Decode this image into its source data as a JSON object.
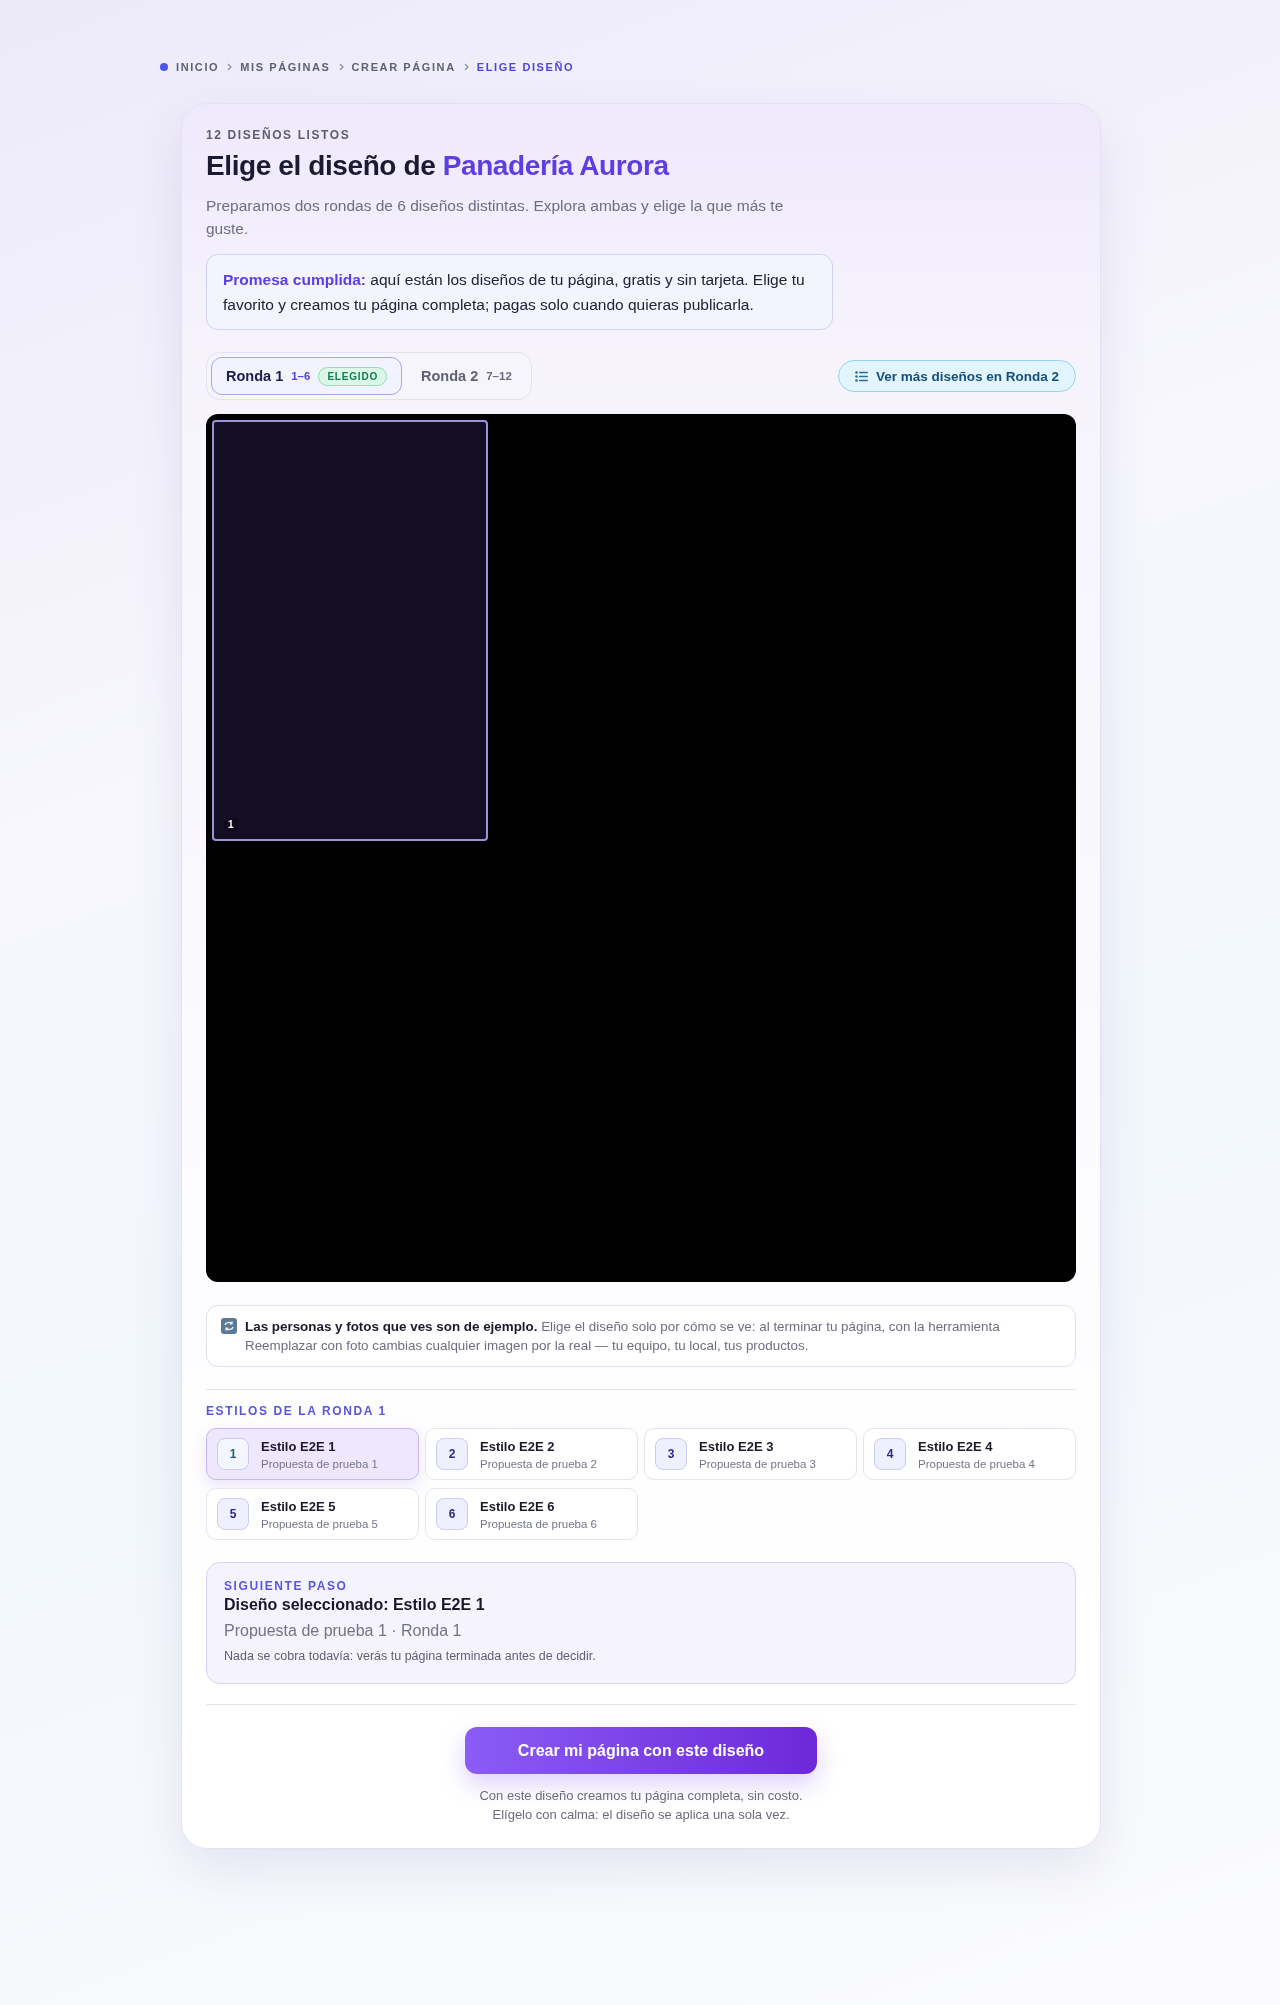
{
  "breadcrumb": [
    {
      "label": "INICIO",
      "current": false
    },
    {
      "label": "MIS PÁGINAS",
      "current": false
    },
    {
      "label": "CREAR PÁGINA",
      "current": false
    },
    {
      "label": "ELIGE DISEÑO",
      "current": true
    }
  ],
  "header": {
    "eyebrow": "12 DISEÑOS LISTOS",
    "title": "Elige el diseño de **Panadería Aurora**",
    "subtitle": "Preparamos dos rondas de 6 diseños distintas. Explora ambas y elige la que más te guste."
  },
  "promise": "**Promesa cumplida:** aquí están los diseños de tu página, gratis y sin tarjeta. Elige tu favorito y creamos tu página completa; pagas solo cuando quieras publicarla.",
  "rounds": [
    {
      "label": "Ronda 1",
      "range": "1–6",
      "badge": "ELEGIDO",
      "selected": true
    },
    {
      "label": "Ronda 2",
      "range": "7–12",
      "selected": false
    }
  ],
  "more_button": "Ver más diseños en Ronda 2",
  "preview": {
    "thumbnails": [
      {
        "label": "1",
        "selected": true
      }
    ]
  },
  "notice": "**Las personas y fotos que ves son de ejemplo.** Elige el diseño solo por cómo se ve: al terminar tu página, con la herramienta Reemplazar con foto cambias cualquier imagen por la real — tu equipo, tu local, tus productos.",
  "styles": {
    "heading": "ESTILOS DE LA RONDA 1",
    "items": [
      {
        "number": "1",
        "name": "Estilo E2E 1",
        "description": "Propuesta de prueba 1",
        "selected": true
      },
      {
        "number": "2",
        "name": "Estilo E2E 2",
        "description": "Propuesta de prueba 2",
        "selected": false
      },
      {
        "number": "3",
        "name": "Estilo E2E 3",
        "description": "Propuesta de prueba 3",
        "selected": false
      },
      {
        "number": "4",
        "name": "Estilo E2E 4",
        "description": "Propuesta de prueba 4",
        "selected": false
      },
      {
        "number": "5",
        "name": "Estilo E2E 5",
        "description": "Propuesta de prueba 5",
        "selected": false
      },
      {
        "number": "6",
        "name": "Estilo E2E 6",
        "description": "Propuesta de prueba 6",
        "selected": false
      }
    ]
  },
  "next_step": {
    "eyebrow": "SIGUIENTE PASO",
    "title": "Diseño seleccionado: Estilo E2E 1",
    "subtitle": "Propuesta de prueba 1 · Ronda 1",
    "note": "Nada se cobra todavía: verás tu página terminada antes de decidir."
  },
  "cta": {
    "button": "Crear mi página con este diseño",
    "lines": [
      "Con este diseño creamos tu página completa, sin costo.",
      "Elígelo con calma: el diseño se aplica una sola vez."
    ]
  }
}
